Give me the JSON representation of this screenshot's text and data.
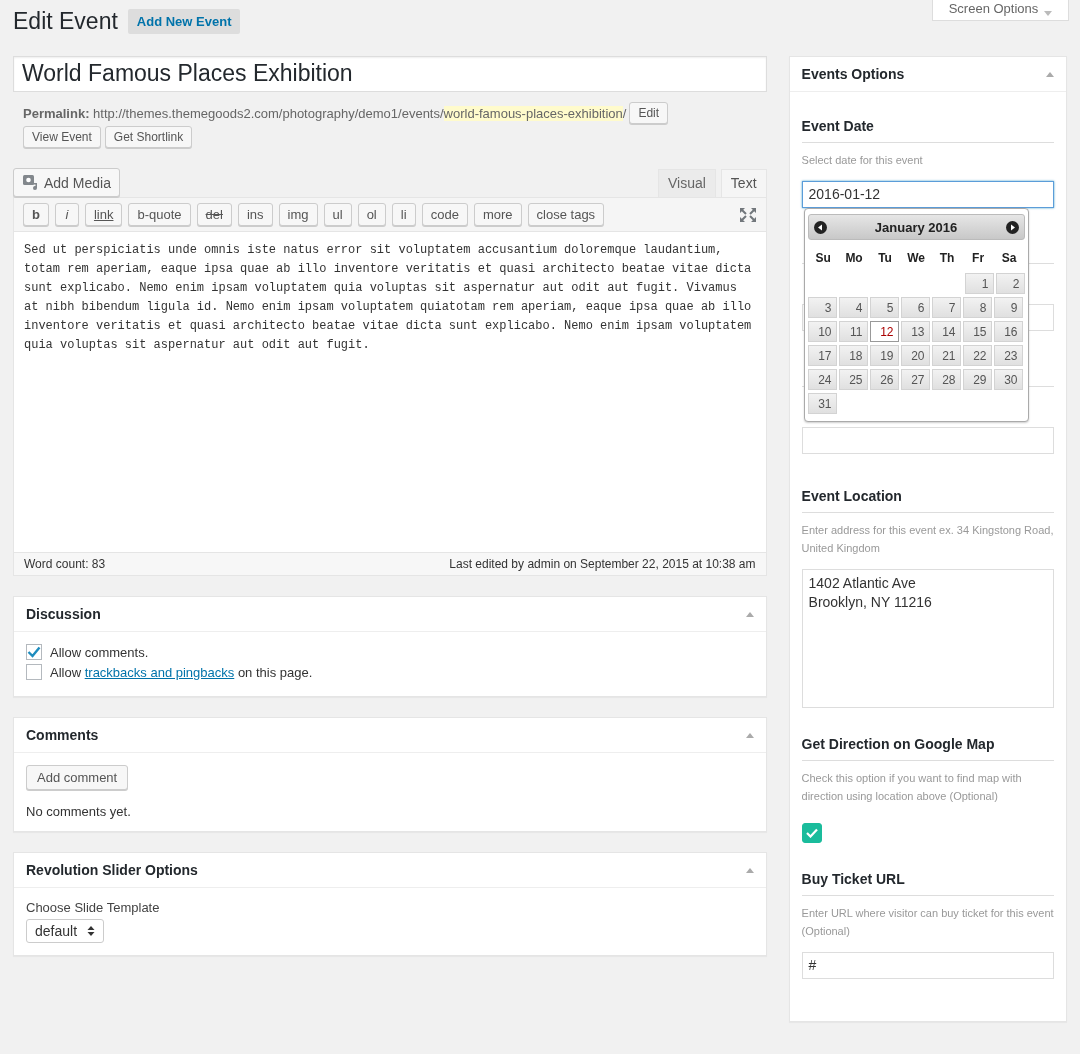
{
  "header": {
    "title": "Edit Event",
    "add_new": "Add New Event",
    "screen_options": "Screen Options"
  },
  "post": {
    "title": "World Famous Places Exhibition",
    "permalink_label": "Permalink:",
    "permalink_base": "http://themes.themegoods2.com/photography/demo1/events/",
    "permalink_slug": "world-famous-places-exhibition",
    "permalink_end": "/",
    "edit_button": "Edit",
    "buttons": [
      "View Event",
      "Get Shortlink"
    ]
  },
  "editor": {
    "add_media": "Add Media",
    "tabs": [
      {
        "label": "Visual",
        "selected": false
      },
      {
        "label": "Text",
        "selected": true
      }
    ],
    "quicktags": [
      {
        "label": "b",
        "kind": "bold"
      },
      {
        "label": "i",
        "kind": "italic"
      },
      {
        "label": "link",
        "kind": "underline"
      },
      {
        "label": "b-quote",
        "kind": "plain"
      },
      {
        "label": "del",
        "kind": "strike"
      },
      {
        "label": "ins",
        "kind": "plain"
      },
      {
        "label": "img",
        "kind": "plain"
      },
      {
        "label": "ul",
        "kind": "plain"
      },
      {
        "label": "ol",
        "kind": "plain"
      },
      {
        "label": "li",
        "kind": "plain"
      },
      {
        "label": "code",
        "kind": "plain"
      },
      {
        "label": "more",
        "kind": "plain"
      },
      {
        "label": "close tags",
        "kind": "plain"
      }
    ],
    "content": "Sed ut perspiciatis unde omnis iste natus error sit voluptatem accusantium doloremque laudantium, totam rem aperiam, eaque ipsa quae ab illo inventore veritatis et quasi architecto beatae vitae dicta sunt explicabo. Nemo enim ipsam voluptatem quia voluptas sit aspernatur aut odit aut fugit. Vivamus at nibh bibendum ligula id. Nemo enim ipsam voluptatem quiatotam rem aperiam, eaque ipsa quae ab illo inventore veritatis et quasi architecto beatae vitae dicta sunt explicabo. Nemo enim ipsam voluptatem quia voluptas sit aspernatur aut odit aut fugit.",
    "word_count": "Word count: 83",
    "last_edited": "Last edited by admin on September 22, 2015 at 10:38 am"
  },
  "discussion": {
    "title": "Discussion",
    "options": [
      {
        "before": "Allow comments.",
        "checked": true
      },
      {
        "before": "Allow ",
        "link": "trackbacks and pingbacks",
        "after": " on this page.",
        "checked": false
      }
    ]
  },
  "comments": {
    "title": "Comments",
    "button": "Add comment",
    "empty": "No comments yet."
  },
  "revslider": {
    "title": "Revolution Slider Options",
    "label": "Choose Slide Template",
    "select": "default"
  },
  "events_options": {
    "title": "Events Options",
    "sections": [
      {
        "kind": "date",
        "title": "Event Date",
        "hint": "Select date for this event",
        "value": "2016-01-12"
      },
      {
        "kind": "covered"
      },
      {
        "kind": "covered"
      },
      {
        "kind": "textarea",
        "title": "Event Location",
        "hint": "Enter address for this event ex. 34 Kingstong Road, United Kingdom",
        "value": "1402 Atlantic Ave\nBrooklyn, NY 11216"
      },
      {
        "kind": "checkbox",
        "title": "Get Direction on Google Map",
        "hint": "Check this option if you want to find map with direction using location above (Optional)",
        "checked": true
      },
      {
        "kind": "text",
        "title": "Buy Ticket URL",
        "hint": "Enter URL where visitor can buy ticket for this event (Optional)",
        "value": "#"
      }
    ]
  },
  "calendar": {
    "month": "January 2016",
    "weekdays": [
      "Su",
      "Mo",
      "Tu",
      "We",
      "Th",
      "Fr",
      "Sa"
    ],
    "weeks": [
      [
        {
          "day": "1",
          "selected": false
        },
        {
          "day": "2",
          "selected": false
        }
      ],
      [
        {
          "day": "3",
          "selected": false
        },
        {
          "day": "4",
          "selected": false
        },
        {
          "day": "5",
          "selected": false
        },
        {
          "day": "6",
          "selected": false
        },
        {
          "day": "7",
          "selected": false
        },
        {
          "day": "8",
          "selected": false
        },
        {
          "day": "9",
          "selected": false
        }
      ],
      [
        {
          "day": "10",
          "selected": false
        },
        {
          "day": "11",
          "selected": false
        },
        {
          "day": "12",
          "selected": true
        },
        {
          "day": "13",
          "selected": false
        },
        {
          "day": "14",
          "selected": false
        },
        {
          "day": "15",
          "selected": false
        },
        {
          "day": "16",
          "selected": false
        }
      ],
      [
        {
          "day": "17",
          "selected": false
        },
        {
          "day": "18",
          "selected": false
        },
        {
          "day": "19",
          "selected": false
        },
        {
          "day": "20",
          "selected": false
        },
        {
          "day": "21",
          "selected": false
        },
        {
          "day": "22",
          "selected": false
        },
        {
          "day": "23",
          "selected": false
        }
      ],
      [
        {
          "day": "24",
          "selected": false
        },
        {
          "day": "25",
          "selected": false
        },
        {
          "day": "26",
          "selected": false
        },
        {
          "day": "27",
          "selected": false
        },
        {
          "day": "28",
          "selected": false
        },
        {
          "day": "29",
          "selected": false
        },
        {
          "day": "30",
          "selected": false
        }
      ],
      [
        {
          "day": "31",
          "selected": false
        }
      ]
    ]
  }
}
